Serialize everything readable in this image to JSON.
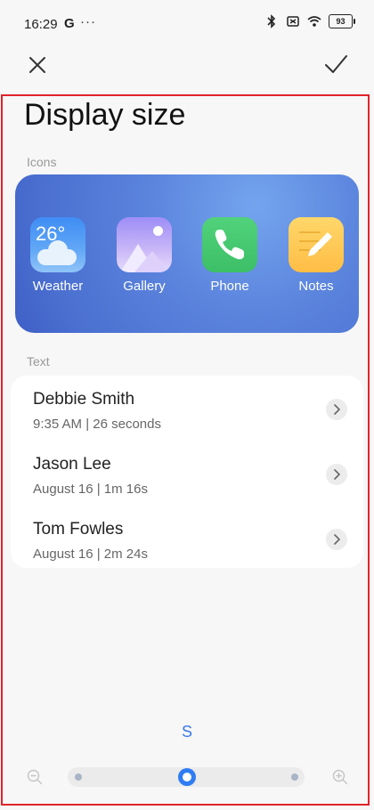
{
  "status_bar": {
    "time": "16:29",
    "g_label": "G",
    "dots": "···",
    "battery": "93"
  },
  "topbar": {
    "close_icon": "close-icon",
    "confirm_icon": "check-icon"
  },
  "title": "Display size",
  "icons_section": {
    "label": "Icons",
    "apps": [
      {
        "label": "Weather",
        "temp": "26°",
        "icon": "weather-icon"
      },
      {
        "label": "Gallery",
        "icon": "gallery-icon"
      },
      {
        "label": "Phone",
        "icon": "phone-icon"
      },
      {
        "label": "Notes",
        "icon": "notes-icon"
      }
    ]
  },
  "text_section": {
    "label": "Text",
    "calls": [
      {
        "name": "Debbie Smith",
        "detail": "9:35 AM | 26 seconds"
      },
      {
        "name": "Jason Lee",
        "detail": "August 16 | 1m 16s"
      },
      {
        "name": "Tom Fowles",
        "detail": "August 16 | 2m 24s"
      }
    ]
  },
  "size_slider": {
    "current_letter": "S",
    "selected_step": 2,
    "steps": 3
  },
  "colors": {
    "accent": "#2f7cf3",
    "frame": "#e0232b"
  }
}
